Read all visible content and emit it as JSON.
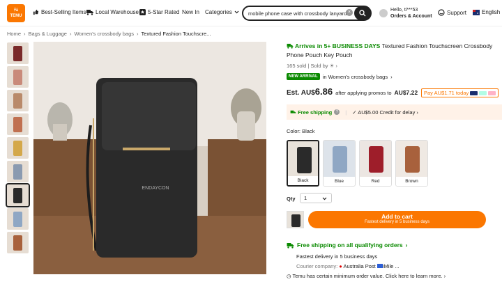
{
  "header": {
    "logo_line1": "ﾃﾑ",
    "logo_line2": "TEMU",
    "nav": [
      "Best-Selling Items",
      "Local Warehouse",
      "5-Star Rated",
      "New In",
      "Categories"
    ],
    "search_value": "mobile phone case with crossbody lanyard",
    "user_hello": "Hello, ti***53",
    "user_orders": "Orders & Account",
    "support": "Support",
    "language": "English"
  },
  "breadcrumb": [
    "Home",
    "Bags & Luggage",
    "Women's crossbody bags",
    "Textured Fashion Touchscre..."
  ],
  "product": {
    "arrives": "Arrives in 5+ BUSINESS DAYS",
    "title": "Textured Fashion Touchscreen Crossbody Phone Pouch Key Pouch",
    "sold": "165 sold",
    "sold_by": "Sold by",
    "new_arrival": "NEW ARRIVAL",
    "category_link": "in Women's crossbody bags",
    "est_label": "Est. AU$",
    "est_price": "6.86",
    "after_promos": "after applying promos to",
    "promo_price": "AU$7.22",
    "pay_after": "Pay AU$1.71 today",
    "pay_colors": [
      "#1a2e6e",
      "#ffb3c7",
      "#b2fce4",
      "#f5d0e0"
    ],
    "free_shipping": "Free shipping",
    "credit": "AU$5.00 Credit for delay",
    "color_label": "Color: Black",
    "colors": [
      {
        "name": "Black",
        "hex": "#2a2a2a",
        "bg": "#e8e2da"
      },
      {
        "name": "Blue",
        "hex": "#8fa7c4",
        "bg": "#dde3ea"
      },
      {
        "name": "Red",
        "hex": "#9e1e2a",
        "bg": "#ece6e2"
      },
      {
        "name": "Brown",
        "hex": "#a8613c",
        "bg": "#efe9e3"
      }
    ],
    "qty_label": "Qty",
    "qty_value": "1",
    "add_to_cart": "Add to cart",
    "cart_sub": "Fastest delivery in 5 business days",
    "free_ship_all": "Free shipping on all qualifying orders",
    "fastest": "Fastest delivery in 5 business days",
    "courier_label": "Courier company:",
    "courier1": "Australia Post",
    "courier2": "iMile",
    "min_order": "Temu has certain minimum order value. Click here to learn more.",
    "brand_on_bag": "ENDAYCON"
  },
  "thumbs": [
    "#7a2a2a",
    "#c98a7a",
    "#b98a6a",
    "#c07050",
    "#d4a84a",
    "#8a9ab0",
    "#2a2a2a",
    "#8fa7c4",
    "#a8613c"
  ],
  "colors": {
    "accent": "#fb7701",
    "green": "#0a8a00"
  }
}
